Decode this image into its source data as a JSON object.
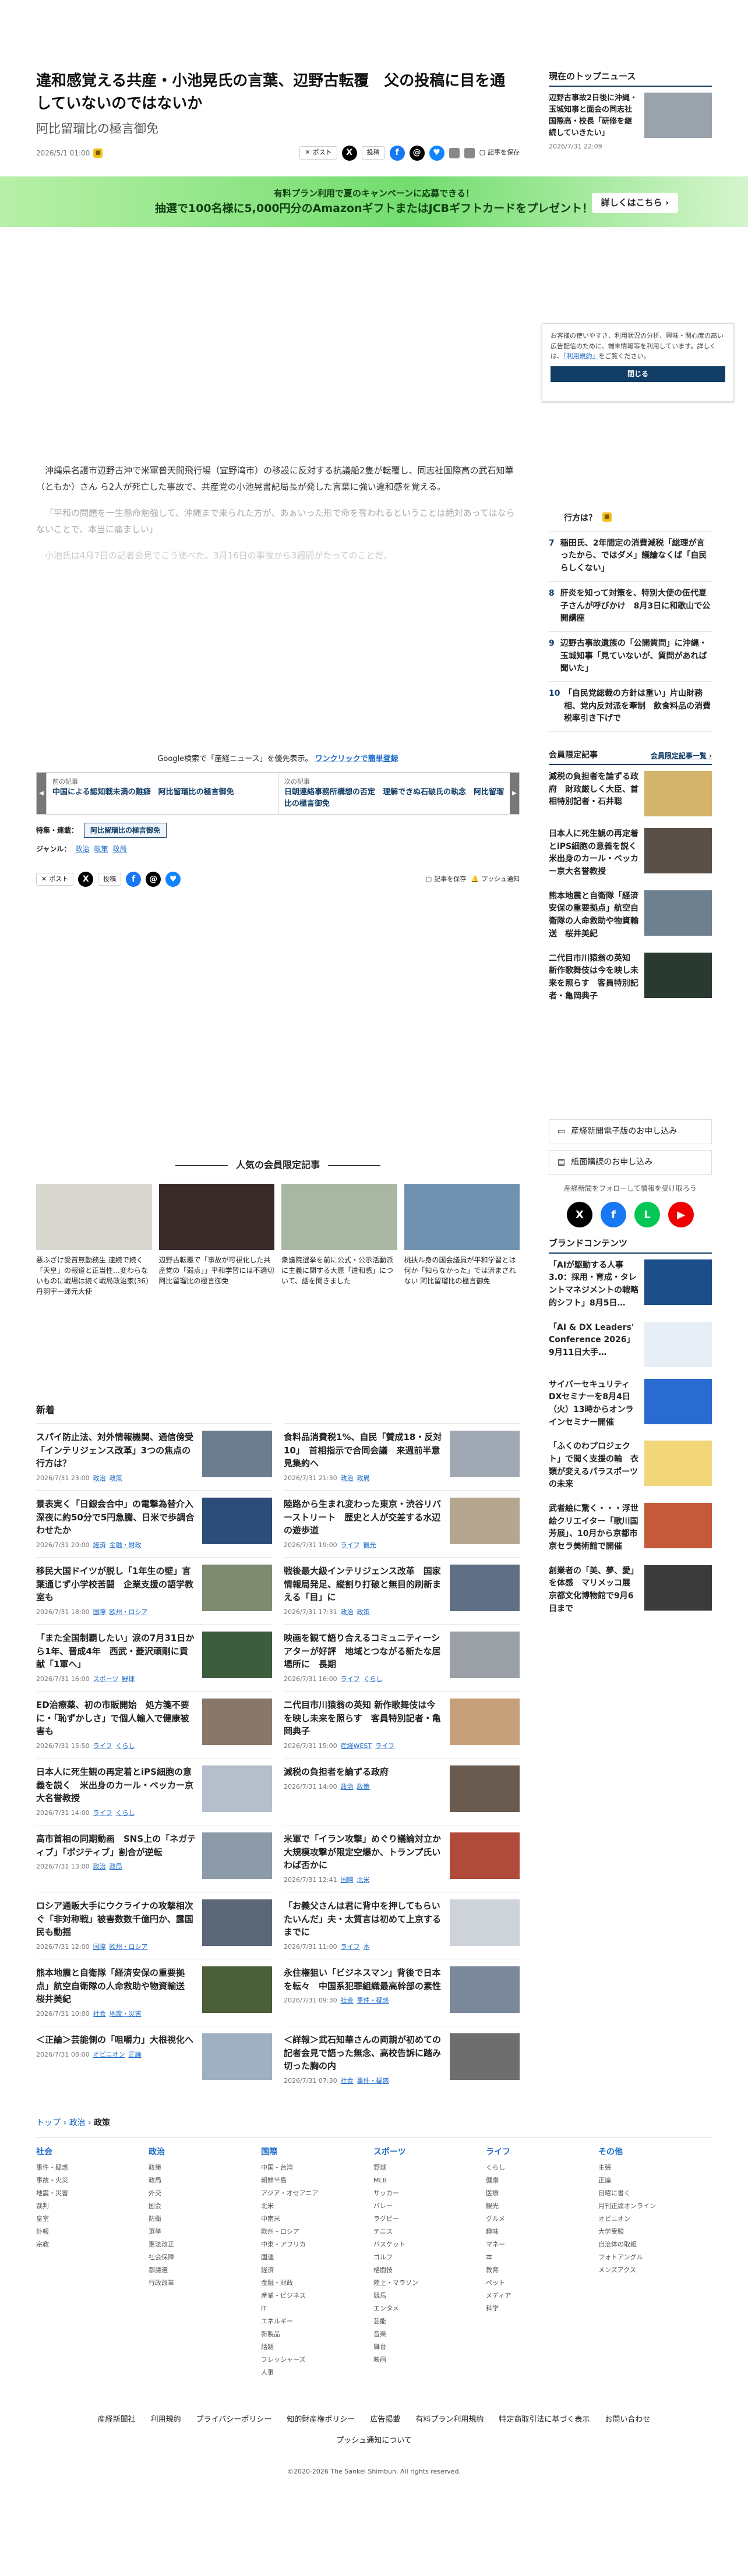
{
  "article": {
    "title": "違和感覚える共産・小池晃氏の言葉、辺野古転覆　父の投稿に目を通していないのではないか",
    "subtitle": "阿比留瑠比の極言御免",
    "date": "2026/5/1 01:00",
    "paragraphs": [
      "沖縄県名護市辺野古沖で米軍普天間飛行場（宜野湾市）の移設に反対する抗議船2隻が転覆し、同志社国際高の武石知華（ともか）さん ら2人が死亡した事故で、共産党の小池晃書記局長が発した言葉に強い違和感を覚える。",
      "「平和の問題を一生懸命勉強して、沖縄まで来られた方が、あぁいった形で命を奪われるということは絶対あってはならないことで、本当に痛ましい」",
      "小池氏は4月7日の記者会見でこう述べた。3月16日の事故から3週間がたってのことだ。"
    ]
  },
  "share": {
    "post_label": "ポスト",
    "share_label": "投稿",
    "save_label": "記事を保存",
    "push_label": "プッシュ通知"
  },
  "banner": {
    "line1": "有料プラン利用で夏のキャンペーンに応募できる！",
    "line2": "抽選で100名様に5,000円分のAmazonギフトまたはJCBギフトカードをプレゼント！",
    "more": "詳しくはこちら ›"
  },
  "top_news": {
    "title": "現在のトップニュース",
    "item_title": "辺野古事故2日後に沖縄・玉城知事と面会の同志社国際高・校長「研修を継続していきたい」",
    "item_date": "2026/7/31 22:09"
  },
  "cookie": {
    "text": "お客様の使いやすさ、利用状況の分析、興味・関心度の高い広告配信のために、端末情報等を利用しています。詳しくは、",
    "link": "「利用規約」",
    "suffix": "をご覧ください。",
    "close": "閉じる"
  },
  "ranking": [
    {
      "num": "",
      "text": "行方は？"
    },
    {
      "num": "7",
      "text": "稲田氏、2年間定の消費減税「総理が言ったから、ではダメ」議論なくば「自民らしくない」"
    },
    {
      "num": "8",
      "text": "肝炎を知って対策を、特別大使の伍代夏子さんが呼びかけ　8月3日に和歌山で公開講座"
    },
    {
      "num": "9",
      "text": "辺野古事故遺族の「公開質問」に沖縄・玉城知事「見ていないが、質問があれば聞いた」"
    },
    {
      "num": "10",
      "text": "「自民党総裁の方針は重い」片山財務相、党内反対派を牽制　飲食料品の消費税率引き下げで"
    }
  ],
  "members": {
    "title": "会員限定記事",
    "more": "会員限定記事一覧 ›",
    "items": [
      "減税の負担者を論ずる政府　財政厳しく大臣、首相特別記者・石井聡",
      "日本人に死生観の再定着とiPS細胞の意義を説く　米出身のカール・ベッカー京大名誉教授",
      "熊本地震と自衛隊「経済安保の重要拠点」航空自衛隊の人命救助や物資輸送　桜井美紀",
      "二代目市川猿翁の英知 新作歌舞伎は今を映し未来を照らす　客員特別記者・亀岡典子"
    ]
  },
  "google": {
    "text": "Google検索で「産経ニュース」を優先表示。",
    "link": "ワンクリックで簡単登録"
  },
  "prevnext": {
    "prev_label": "前の記事",
    "prev_title": "中国による認知戦未満の難癖　阿比留瑠比の極言御免",
    "next_label": "次の記事",
    "next_title": "日朝連絡事務所構想の否定　理解できぬ石破氏の執念　阿比留瑠比の極言御免"
  },
  "feature": {
    "label": "特集・連載：",
    "tag": "阿比留瑠比の極言御免"
  },
  "genre": {
    "label": "ジャンル：",
    "items": [
      "政治",
      "政策",
      "政局"
    ]
  },
  "side_boxes": {
    "paper": "産経新聞電子版のお申し込み",
    "sub": "紙面購読のお申し込み",
    "follow": "産経新聞をフォローして情報を受け取ろう"
  },
  "brand": {
    "title": "ブランドコンテンツ",
    "items": [
      "「AIが駆動する人事3.0：採用・育成・タレントマネジメントの戦略的シフト」8月5日…",
      "「AI & DX Leaders' Conference 2026」9月11日大手…",
      "サイバーセキュリティDXセミナーを8月4日（火）13時からオンラインセミナー開催",
      "「ふくのわプロジェクト」で聞く支援の輪　衣類が変えるパラスポーツの未来",
      "武者絵に驚く・・・浮世絵クリエイター「歌川国芳展」、10月から京都市京セラ美術館で開催",
      "創業者の「美、夢、愛」を体感　マリメッコ展　京都文化博物館で9月6日まで"
    ]
  },
  "popular": {
    "title": "人気の会員限定記事",
    "items": [
      "悪ふざけ受賞無勤務生 連続で続く「天皇」の報道と正当性…変わらないものに戦場は続く戦局政治家(36) 丹羽宇一郎元大使",
      "辺野古転覆で「事故が可視化した共産党の「弱点」」平和学習には不適切 阿比留瑠比の極言御免",
      "衆議院選挙を前に公式・公示活動派に主義に関する大原「違和感」について、話を聞きました",
      "桃扶ル身の国会議員が平和学習とは何か「知らなかった」では済まされない 阿比留瑠比の極言御免"
    ]
  },
  "news": {
    "title": "新着",
    "items": [
      {
        "t": "スパイ防止法、対外情報機関、通信傍受「インテリジェンス改革」3つの焦点の行方は？",
        "d": "2026/7/31 23:00",
        "c1": "政治",
        "c2": "政策"
      },
      {
        "t": "食料品消費税1%、自民「賛成18・反対10」　首相指示で合同会議　来週前半意見集約へ",
        "d": "2026/7/31 21:30",
        "c1": "政治",
        "c2": "政局"
      },
      {
        "t": "景表実く「日銀会合中」の電撃為替介入　深夜に約50分で5円急騰、日米で歩調合わせたか",
        "d": "2026/7/31 20:00",
        "c1": "経済",
        "c2": "金融・財政"
      },
      {
        "t": "陸路から生まれ変わった東京・渋谷リバーストリート　歴史と人が交差する水辺の遊歩道",
        "d": "2026/7/31 19:00",
        "c1": "ライフ",
        "c2": "観光"
      },
      {
        "t": "移民大国ドイツが脱し「1年生の壁」言葉通じず小学校苦闘　企業支援の語学教室も",
        "d": "2026/7/31 18:00",
        "c1": "国際",
        "c2": "欧州・ロシア"
      },
      {
        "t": "戦後最大級インテリジェンス改革　国家情報局発足、縦割り打破と無目的刷新まえる「目」に",
        "d": "2026/7/31 17:31",
        "c1": "政治",
        "c2": "政策"
      },
      {
        "t": "「また全国制覇したい」涙の7月31日から1年、晋成4年　西武・菱沢頑剛に貢献「1軍へ」",
        "d": "2026/7/31 16:00",
        "c1": "スポーツ",
        "c2": "野球"
      },
      {
        "t": "映画を観て語り合えるコミュニティーシアターが好評　地域とつながる新たな居場所に　長期",
        "d": "2026/7/31 16:00",
        "c1": "ライフ",
        "c2": "くらし"
      },
      {
        "t": "ED治療薬、初の市販開始　処方箋不要に・「恥ずかしさ」で個人輸入で健康被害も",
        "d": "2026/7/31 15:50",
        "c1": "ライフ",
        "c2": "くらし"
      },
      {
        "t": "二代目市川猿翁の英知 新作歌舞伎は今を映し未来を照らす　客員特別記者・亀岡典子",
        "d": "2026/7/31 15:00",
        "c1": "産経WEST",
        "c2": "ライフ"
      },
      {
        "t": "日本人に死生観の再定着とiPS細胞の意義を説く　米出身のカール・ベッカー京大名誉教授",
        "d": "2026/7/31 14:00",
        "c1": "ライフ",
        "c2": "くらし"
      },
      {
        "t": "減税の負担者を論ずる政府",
        "d": "2026/7/31 14:00",
        "c1": "政治",
        "c2": "政策"
      },
      {
        "t": "高市首相の同期動画　SNS上の「ネガティブ」「ポジティブ」割合が逆転",
        "d": "2026/7/31 13:00",
        "c1": "政治",
        "c2": "政局"
      },
      {
        "t": "米軍で「イラン攻撃」めぐり議論対立か　大規模攻撃が限定空爆か、トランプ氏いわば否かに",
        "d": "2026/7/31 12:41",
        "c1": "国際",
        "c2": "北米"
      },
      {
        "t": "ロシア通販大手にウクライナの攻撃相次ぐ「非対称戦」被害数数千億円か、露国民も動揺",
        "d": "2026/7/31 12:00",
        "c1": "国際",
        "c2": "欧州・ロシア"
      },
      {
        "t": "「お義父さんは君に背中を押してもらいたいんだ」夫・太質言は初めて上京するまでに",
        "d": "2026/7/31 11:00",
        "c1": "ライフ",
        "c2": "本"
      },
      {
        "t": "熊本地震と自衛隊「経済安保の重要拠点」航空自衛隊の人命救助や物資輸送　桜井美紀",
        "d": "2026/7/31 10:00",
        "c1": "社会",
        "c2": "地震・災害"
      },
      {
        "t": "永住権狙い「ビジネスマン」背後で日本を転々　中国系犯罪組織最高幹部の素性",
        "d": "2026/7/31 09:30",
        "c1": "社会",
        "c2": "事件・疑惑"
      },
      {
        "t": "＜正論＞芸能側の「咀嚼力」大根視化へ",
        "d": "2026/7/31 08:00",
        "c1": "オピニオン",
        "c2": "正論"
      },
      {
        "t": "＜詳報＞武石知華さんの両親が初めての記者会見で語った無念、高校告訴に踏み切った胸の内",
        "d": "2026/7/31 07:30",
        "c1": "社会",
        "c2": "事件・疑惑"
      }
    ]
  },
  "breadcrumb": {
    "home": "トップ",
    "sep": " › ",
    "politics": "政治",
    "current": "政策"
  },
  "footer_cols": [
    {
      "h": "社会",
      "items": [
        "事件・疑惑",
        "事故・火災",
        "地震・災害",
        "裁判",
        "皇室",
        "訃報",
        "宗教"
      ]
    },
    {
      "h": "政治",
      "items": [
        "政策",
        "政局",
        "外交",
        "国会",
        "防衛",
        "選挙",
        "憲法改正",
        "社会保障",
        "都議選",
        "行政改革"
      ]
    },
    {
      "h": "国際",
      "items": [
        "中国・台湾",
        "朝鮮半島",
        "アジア・オセアニア",
        "北米",
        "中南米",
        "欧州・ロシア",
        "中東・アフリカ",
        "国連",
        "経済",
        "金融・財政",
        "産業・ビジネス",
        "IT",
        "エネルギー",
        "新製品",
        "話題",
        "フレッシャーズ",
        "人事"
      ]
    },
    {
      "h": "スポーツ",
      "items": [
        "野球",
        "MLB",
        "サッカー",
        "バレー",
        "ラグビー",
        "テニス",
        "バスケット",
        "ゴルフ",
        "格闘技",
        "陸上・マラソン",
        "競馬",
        "エンタメ",
        "芸能",
        "音楽",
        "舞台",
        "映画"
      ]
    },
    {
      "h": "ライフ",
      "items": [
        "くらし",
        "健康",
        "医療",
        "観光",
        "グルメ",
        "趣味",
        "マネー",
        "本",
        "教育",
        "ペット",
        "メディア",
        "科学"
      ]
    },
    {
      "h": "その他",
      "items": [
        "主張",
        "正論",
        "日曜に書く",
        "月刊正論オンライン",
        "オピニオン",
        "大学受験",
        "自治体の取組",
        "フォトアングル",
        "メンズアクス"
      ]
    }
  ],
  "bottom_links": [
    "産経新聞社",
    "利用規約",
    "プライバシーポリシー",
    "知的財産権ポリシー",
    "広告掲載",
    "有料プラン利用規約",
    "特定商取引法に基づく表示",
    "お問い合わせ"
  ],
  "push_link": "プッシュ通知について",
  "copyright": "©2020-2026 The Sankei Shimbun. All rights reserved.",
  "colors": {
    "accent": "#123d66",
    "link": "#1b6ac9",
    "banner": "#72dd6e"
  }
}
